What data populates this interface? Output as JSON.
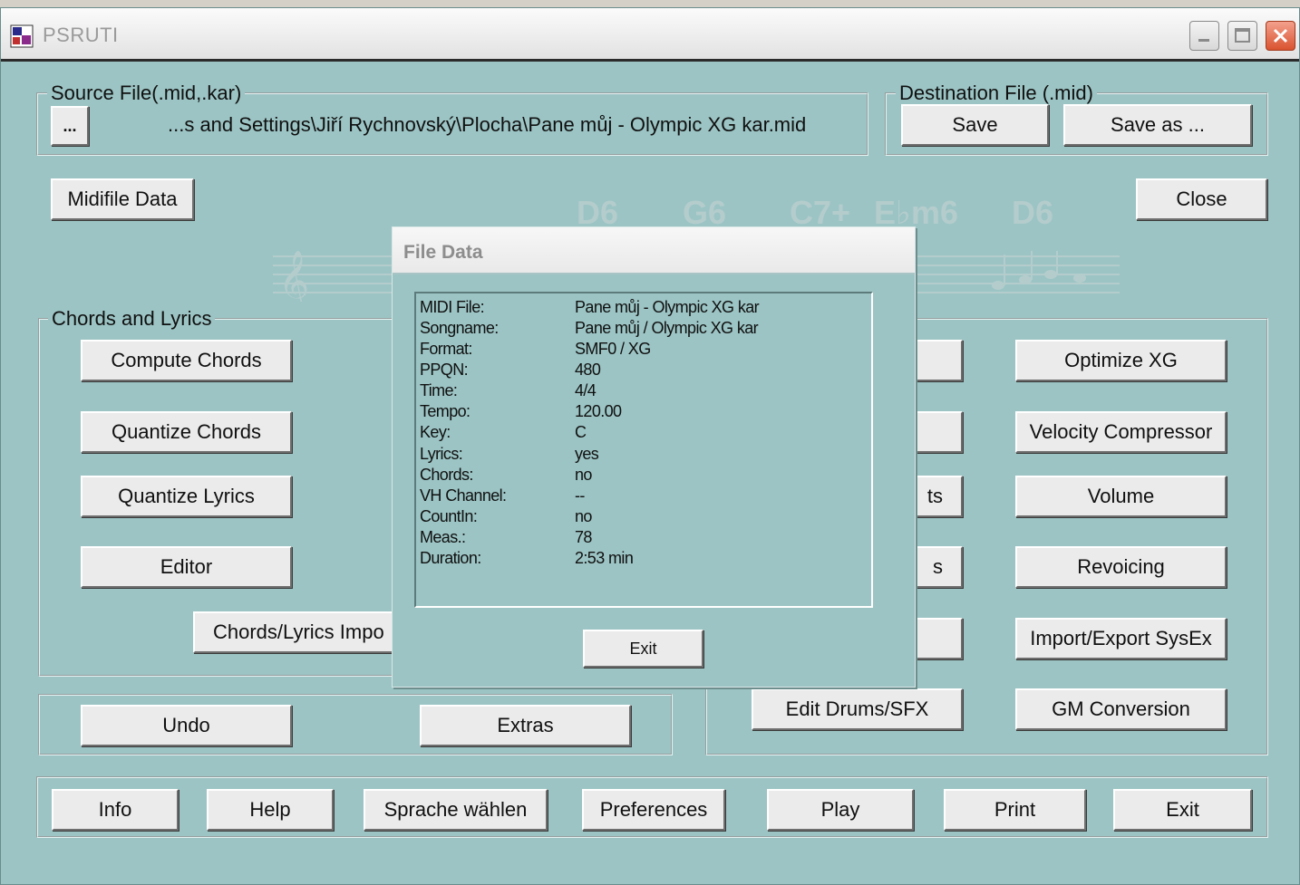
{
  "window": {
    "title": "PSRUTI"
  },
  "source": {
    "group_label": "Source File(.mid,.kar)",
    "browse_label": "...",
    "path": "...s and Settings\\Jiří Rychnovský\\Plocha\\Pane můj - Olympic XG kar.mid"
  },
  "destination": {
    "group_label": "Destination File (.mid)",
    "save_label": "Save",
    "save_as_label": "Save as ..."
  },
  "top_buttons": {
    "midifile_data": "Midifile Data",
    "close": "Close"
  },
  "background_chords": [
    "D6",
    "G6",
    "C7+",
    "E♭m6",
    "D6"
  ],
  "chords_lyrics": {
    "group_label": "Chords and Lyrics",
    "compute_chords": "Compute Chords",
    "quantize_chords": "Quantize Chords",
    "quantize_lyrics": "Quantize Lyrics",
    "editor": "Editor",
    "import_export_clipped": "Chords/Lyrics Impo"
  },
  "undo_extras": {
    "undo": "Undo",
    "extras": "Extras"
  },
  "right_panel": {
    "partial_3": "ts",
    "partial_4": "s",
    "optimize_xg": "Optimize XG",
    "velocity_compressor": "Velocity Compressor",
    "volume": "Volume",
    "revoicing": "Revoicing",
    "import_export_sysex": "Import/Export SysEx",
    "edit_drums": "Edit Drums/SFX",
    "gm_conversion": "GM Conversion"
  },
  "bottom_bar": {
    "info": "Info",
    "help": "Help",
    "language": "Sprache wählen",
    "preferences": "Preferences",
    "play": "Play",
    "print": "Print",
    "exit": "Exit"
  },
  "file_dialog": {
    "title": "File Data",
    "rows": [
      {
        "key": "MIDI File:",
        "value": "Pane můj - Olympic XG kar"
      },
      {
        "key": "Songname:",
        "value": "Pane můj / Olympic  XG kar"
      },
      {
        "key": "Format:",
        "value": "SMF0 / XG"
      },
      {
        "key": "PPQN:",
        "value": "480"
      },
      {
        "key": "Time:",
        "value": "4/4"
      },
      {
        "key": "Tempo:",
        "value": "120.00"
      },
      {
        "key": "Key:",
        "value": "C"
      },
      {
        "key": "Lyrics:",
        "value": "yes"
      },
      {
        "key": "Chords:",
        "value": "no"
      },
      {
        "key": "VH Channel:",
        "value": "--"
      },
      {
        "key": "CountIn:",
        "value": "no"
      },
      {
        "key": "Meas.:",
        "value": "78"
      },
      {
        "key": "Duration:",
        "value": "2:53 min"
      }
    ],
    "exit_label": "Exit"
  },
  "colors": {
    "window_bg": "#9cc4c4",
    "button_face": "#ebebeb",
    "close_button": "#d9532f"
  }
}
